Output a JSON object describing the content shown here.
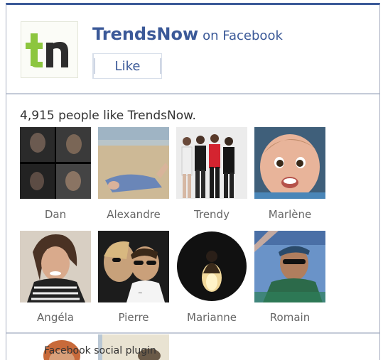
{
  "page": {
    "name": "TrendsNow",
    "suffix": "on Facebook",
    "logo_text": "tn"
  },
  "like_button": {
    "label": "Like"
  },
  "likes": {
    "summary": "4,915 people like TrendsNow."
  },
  "fans": [
    {
      "name": "Dan"
    },
    {
      "name": "Alexandre"
    },
    {
      "name": "Trendy"
    },
    {
      "name": "Marlène"
    },
    {
      "name": "Angéla"
    },
    {
      "name": "Pierre"
    },
    {
      "name": "Marianne"
    },
    {
      "name": "Romain"
    }
  ],
  "footer": {
    "plugin_label": "Facebook social plugin"
  },
  "colors": {
    "brand": "#3b5998",
    "logo_green": "#8cc63f"
  }
}
